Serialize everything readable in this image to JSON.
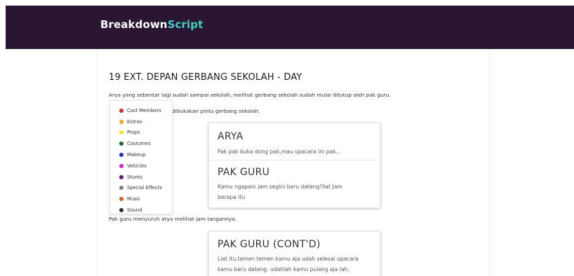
{
  "brand": {
    "part1": "Breakdown",
    "part2": "Script"
  },
  "scene": {
    "heading": "19 EXT. DEPAN GERBANG SEKOLAH - DAY",
    "action1": "Arya yang sebentar lagi sudah sampai sekolah, melihat gerbang sekolah sudah mulai ditutup oleh pak guru.",
    "action2": "dibukakan pintu gerbang sekolah.",
    "action3": "Pak guru menyuruh arya melihat jam tangannya."
  },
  "legend": {
    "items": [
      {
        "label": "Cast Members",
        "color": "#d32f2f"
      },
      {
        "label": "Extras",
        "color": "#f5a623"
      },
      {
        "label": "Props",
        "color": "#f8e71c"
      },
      {
        "label": "Costumes",
        "color": "#1b6e2a"
      },
      {
        "label": "Makeup",
        "color": "#1f2fbf"
      },
      {
        "label": "Vehicles",
        "color": "#d61fd6"
      },
      {
        "label": "Stunts",
        "color": "#5a1a6e"
      },
      {
        "label": "Special Effects",
        "color": "#808080"
      },
      {
        "label": "Music",
        "color": "#c8641e"
      },
      {
        "label": "Sound",
        "color": "#2b2b2b"
      }
    ]
  },
  "dialogs": [
    {
      "character": "ARYA",
      "line": "Pak pak buka dong pak,mau upacara ini pak.."
    },
    {
      "character": "PAK GURU",
      "line1": "Kamu ngapain jam segini baru dateng?liat Jam",
      "line2": "berapa itu"
    },
    {
      "character": "PAK GURU (CONT'D)",
      "line1": "Liat itu,temen temen kamu aja udah selesai upacara",
      "line2": "kamu baru dateng. udahlah kamu pulang aja lah."
    }
  ],
  "colors": {
    "header_bg": "#2a1533",
    "brand_accent": "#3fd3c3"
  }
}
